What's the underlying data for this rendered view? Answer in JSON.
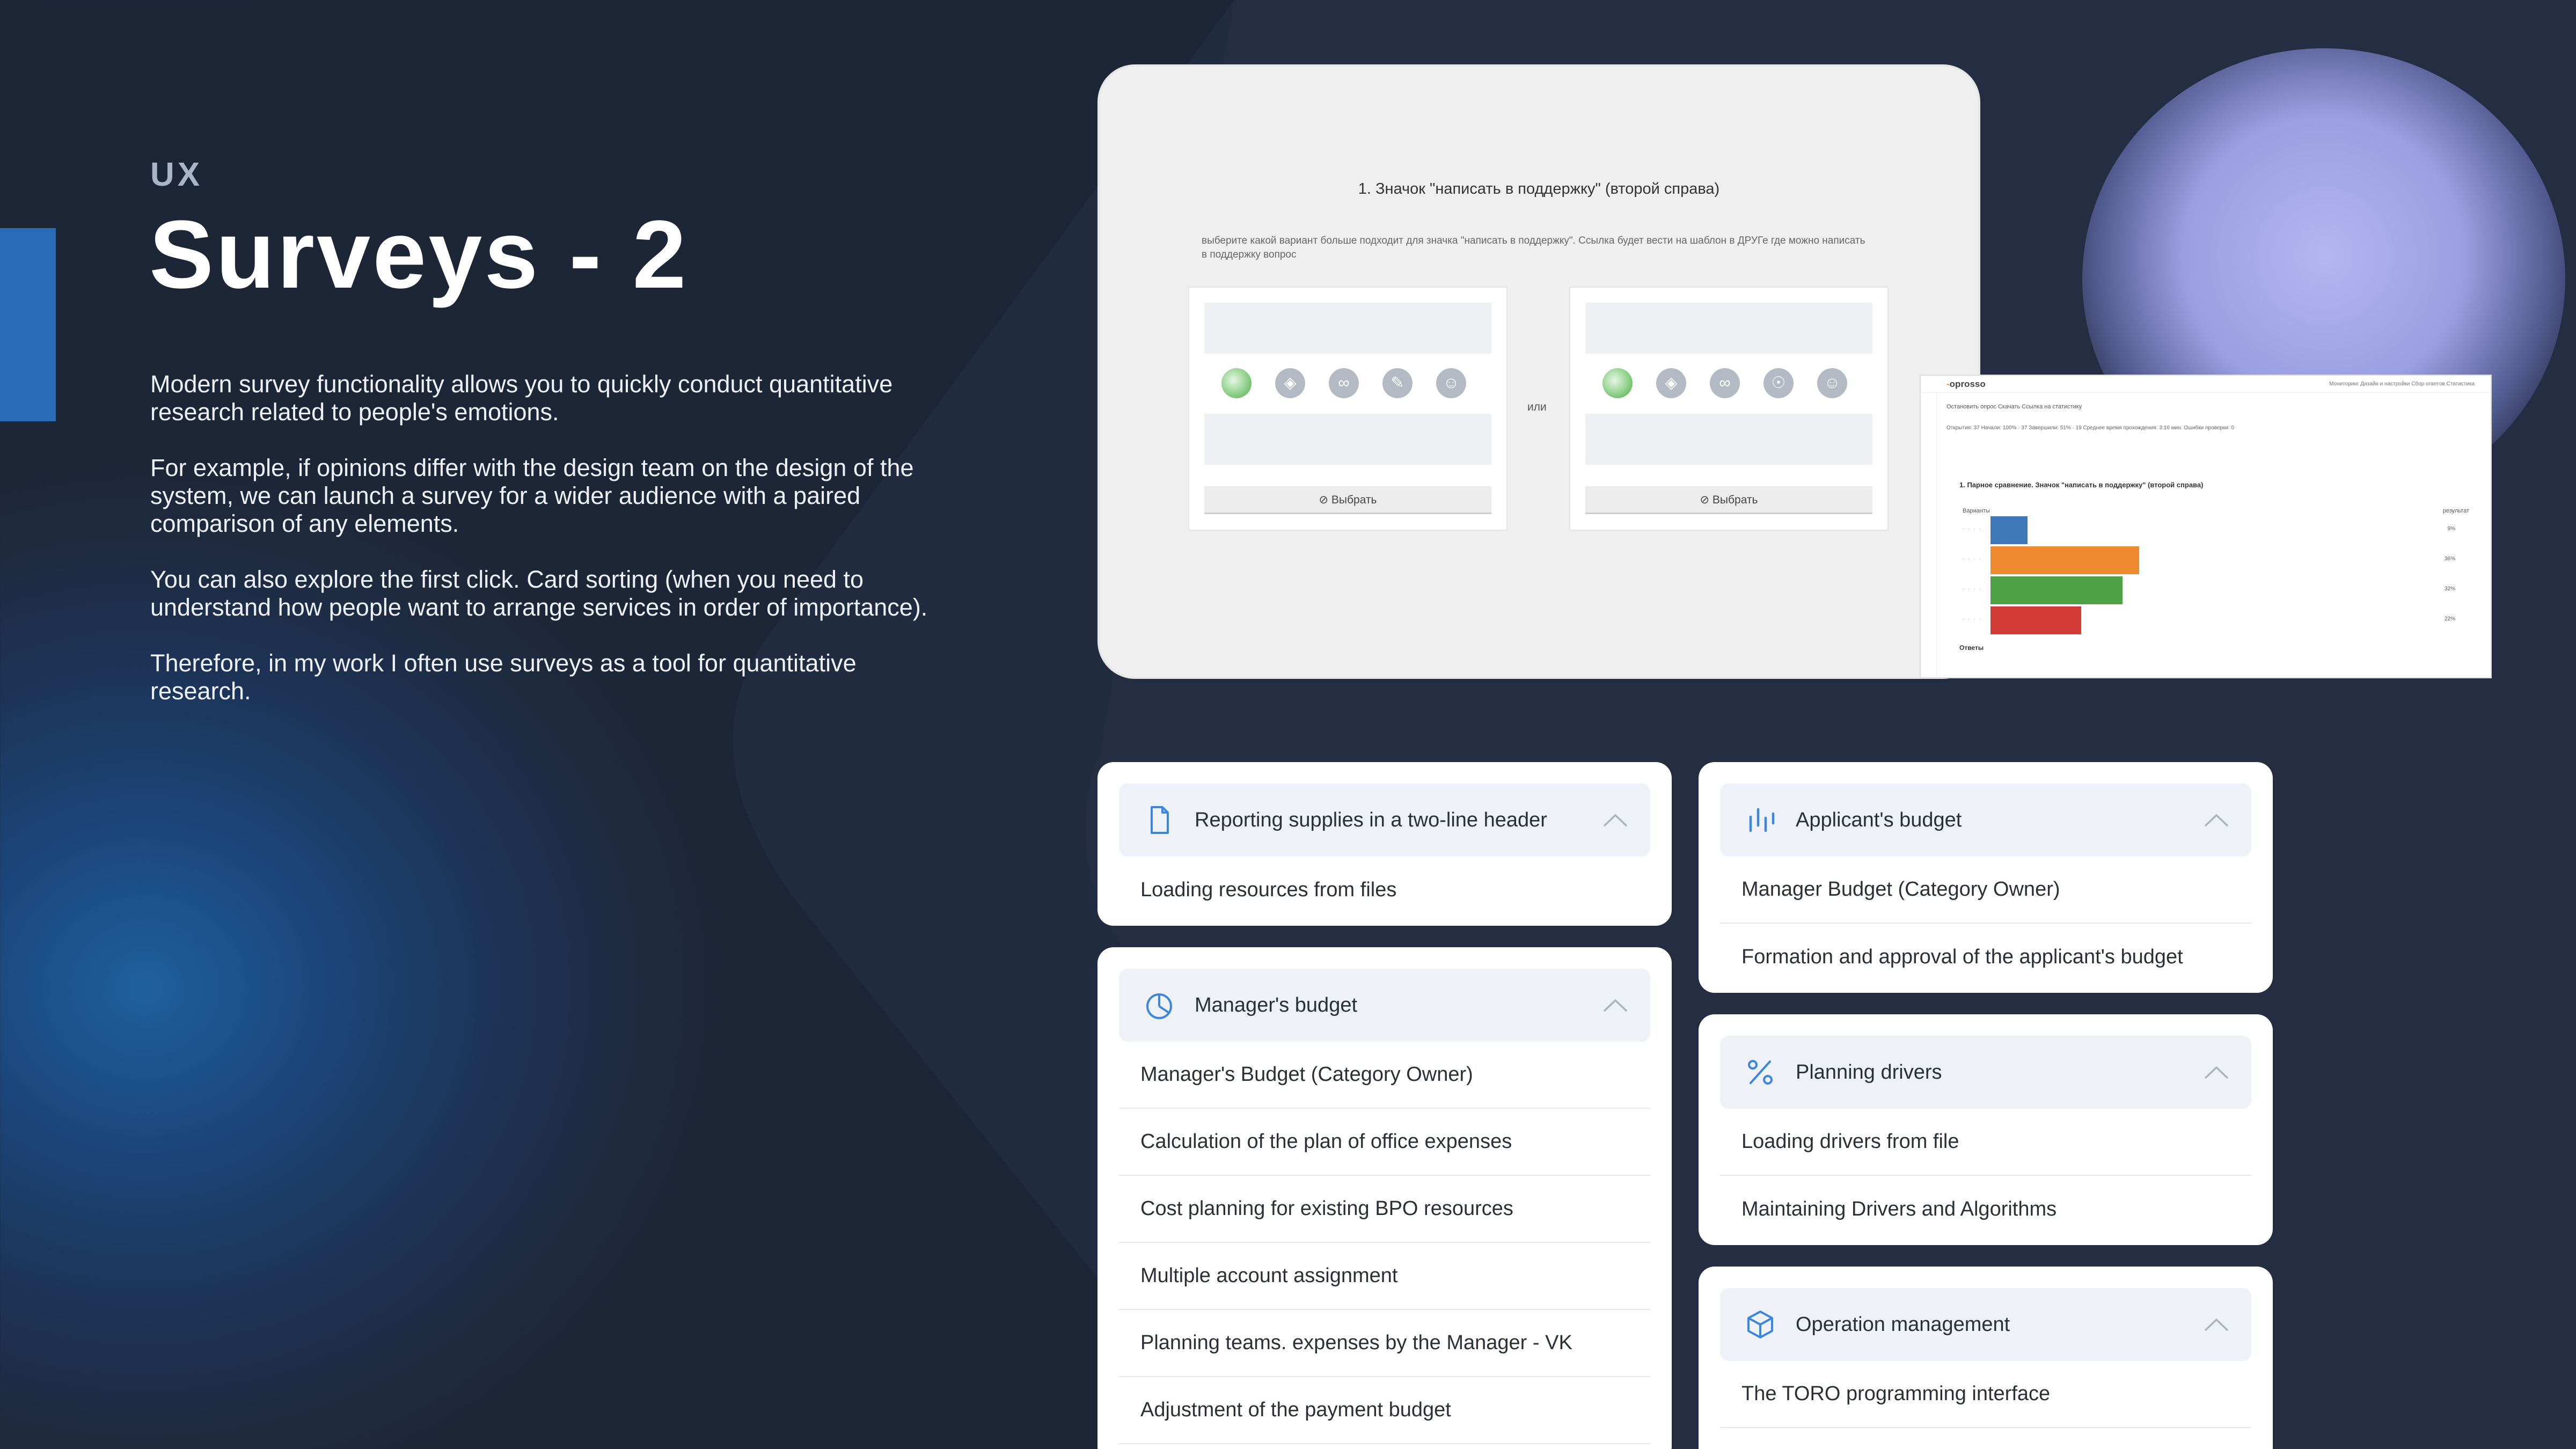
{
  "slide": {
    "kicker": "UX",
    "title": "Surveys - 2",
    "paragraphs": [
      "Modern survey functionality allows you to quickly conduct quantitative research related to people's emotions.",
      "For example, if opinions differ with the design team on the design of the system, we can launch a survey for a wider audience with a paired comparison of any elements.",
      "You can also explore the first click. Card sorting (when you need to understand how people want to arrange services in order of importance).",
      "Therefore, in my work I often use surveys as a tool for quantitative research."
    ]
  },
  "survey_screenshot": {
    "question": "1. Значок \"написать в поддержку\" (второй справа)",
    "hint": "выберите какой вариант больше подходит для значка \"написать в поддержку\". Ссылка будет вести на шаблон в ДРУГе где можно написать в поддержку вопрос",
    "or_label": "или",
    "choose_label": "⊘ Выбрать",
    "option_icons": [
      "check-circle-icon",
      "bell-icon",
      "link-icon",
      "pencil-icon",
      "user-icon"
    ],
    "option_icons_b": [
      "check-circle-icon",
      "bell-icon",
      "link-icon",
      "headset-icon",
      "user-icon"
    ]
  },
  "stats_screenshot": {
    "logo_prefix": "-",
    "logo": "oprosso",
    "tabs": "Мониторинг   Дизайн и настройки   Сбор ответов   Статистика",
    "toolbar": "Остановить опрос   Скачать   Ссылка на статистику",
    "meta": "Открытия: 37    Начали: 100% · 37    Завершили: 51% · 19    Среднее время прохождения: 3:16 мин.    Ошибки проверки: 0",
    "chart_title": "1. Парное сравнение. Значок \"написать в поддержку\" (второй справа)",
    "col_left": "Варианты",
    "col_right": "результат",
    "answers_label": "Ответы",
    "colors": [
      "#3f77b9",
      "#f08a30",
      "#4ea145",
      "#d23b36"
    ]
  },
  "chart_data": {
    "type": "bar",
    "categories": [
      "",
      "",
      "",
      ""
    ],
    "values": [
      9,
      36,
      32,
      22
    ],
    "labels": [
      "9%",
      "36%",
      "32%",
      "22%"
    ]
  },
  "cards": [
    {
      "id": "reporting",
      "icon": "document-icon",
      "header": "Reporting supplies in a  two-line header",
      "items": [
        "Loading resources from files"
      ]
    },
    {
      "id": "manager",
      "icon": "pie-chart-icon",
      "header": "Manager's budget",
      "items": [
        "Manager's Budget (Category Owner)",
        "Calculation of the plan of office expenses",
        "Cost planning for existing BPO resources",
        "Multiple account assignment",
        "Planning teams. expenses by the Manager - VK",
        "Adjustment of the payment budget"
      ]
    },
    {
      "id": "applicant",
      "icon": "bar-chart-icon",
      "header": "Applicant's budget",
      "items": [
        "Manager Budget (Category Owner)",
        "Formation and approval of the applicant's budget"
      ]
    },
    {
      "id": "drivers",
      "icon": "percent-icon",
      "header": "Planning drivers",
      "items": [
        "Loading drivers from file",
        "Maintaining Drivers and Algorithms"
      ]
    },
    {
      "id": "operation",
      "icon": "cube-icon",
      "header": "Operation management",
      "items": [
        "The TORO programming interface"
      ]
    }
  ]
}
